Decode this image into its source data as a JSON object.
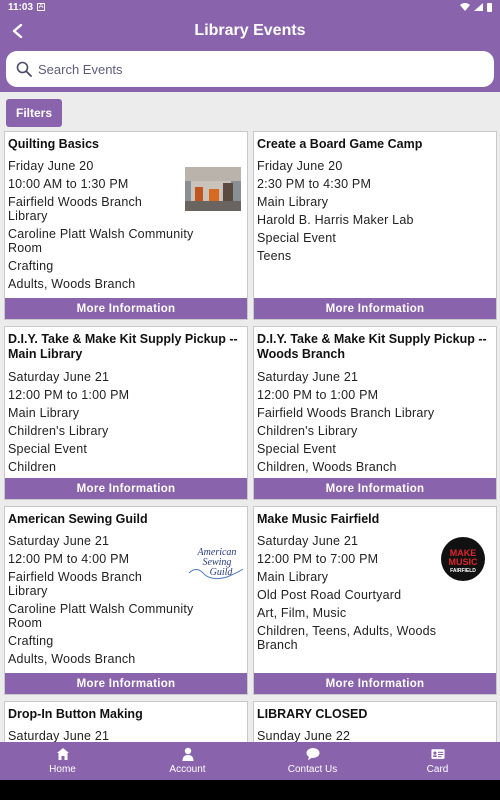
{
  "status": {
    "time": "11:03",
    "note_glyph": "A"
  },
  "header": {
    "title": "Library Events",
    "back": "back-arrow-icon"
  },
  "search": {
    "placeholder": "Search Events",
    "icon": "search-icon"
  },
  "filters_label": "Filters",
  "more_label": "More Information",
  "events": [
    {
      "title": "Quilting Basics",
      "lines": [
        "Friday June 20",
        "10:00 AM to 1:30 PM",
        "Fairfield Woods Branch Library",
        "Caroline Platt Walsh Community Room",
        "Crafting",
        "Adults, Woods Branch"
      ]
    },
    {
      "title": "Create a Board Game Camp",
      "lines": [
        "Friday June 20",
        "2:30 PM to 4:30 PM",
        "Main Library",
        "Harold B. Harris Maker Lab",
        "Special Event",
        "Teens"
      ]
    },
    {
      "title": "D.I.Y. Take & Make Kit Supply Pickup -- Main Library",
      "lines": [
        "Saturday June 21",
        "12:00 PM to 1:00 PM",
        "Main Library",
        "Children's Library",
        "Special Event",
        "Children"
      ]
    },
    {
      "title": "D.I.Y. Take & Make Kit Supply Pickup -- Woods Branch",
      "lines": [
        "Saturday June 21",
        "12:00 PM to 1:00 PM",
        "Fairfield Woods Branch Library",
        "Children's Library",
        "Special Event",
        "Children, Woods Branch"
      ]
    },
    {
      "title": "American Sewing Guild",
      "lines": [
        "Saturday June 21",
        "12:00 PM to 4:00 PM",
        "Fairfield Woods Branch Library",
        "Caroline Platt Walsh Community Room",
        "Crafting",
        "Adults, Woods Branch"
      ],
      "logo_text": [
        "American",
        "Sewing",
        "Guild"
      ]
    },
    {
      "title": "Make Music Fairfield",
      "lines": [
        "Saturday June 21",
        "12:00 PM to 7:00 PM",
        "Main Library",
        "Old Post Road Courtyard",
        "Art, Film, Music",
        "Children, Teens, Adults, Woods Branch"
      ],
      "logo_text": [
        "MAKE",
        "MUSIC",
        "FAIRFIELD"
      ]
    },
    {
      "title": "Drop-In Button Making",
      "lines": [
        "Saturday June 21"
      ]
    },
    {
      "title": "LIBRARY CLOSED",
      "lines": [
        "Sunday June 22"
      ]
    }
  ],
  "bottom_nav": [
    {
      "label": "Home",
      "icon": "home-icon"
    },
    {
      "label": "Account",
      "icon": "person-icon"
    },
    {
      "label": "Contact Us",
      "icon": "chat-bubble-icon"
    },
    {
      "label": "Card",
      "icon": "id-card-icon"
    }
  ],
  "colors": {
    "accent": "#8a63ad",
    "background": "#ececec"
  }
}
